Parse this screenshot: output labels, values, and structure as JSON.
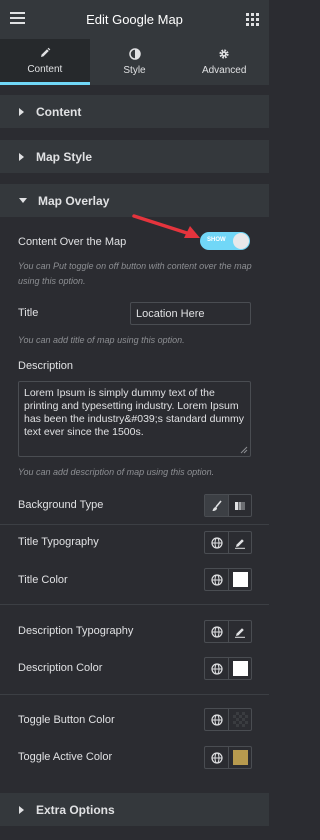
{
  "header": {
    "title": "Edit Google Map"
  },
  "tabs": [
    {
      "label": "Content",
      "active": true
    },
    {
      "label": "Style",
      "active": false
    },
    {
      "label": "Advanced",
      "active": false
    }
  ],
  "sections": {
    "content": "Content",
    "map_style": "Map Style",
    "map_overlay": "Map Overlay",
    "extra_options": "Extra Options"
  },
  "overlay": {
    "content_over_map": {
      "label": "Content Over the Map",
      "toggle_text": "SHOW",
      "enabled": true,
      "help": "You can Put toggle on off button with content over the map using this option."
    },
    "title": {
      "label": "Title",
      "value": "Location Here",
      "help": "You can add title of map using this option."
    },
    "description": {
      "label": "Description",
      "value": "Lorem Ipsum is simply dummy text of the printing and typesetting industry. Lorem Ipsum has been the industry&#039;s standard dummy text ever since the 1500s.",
      "help": "You can add description of map using this option."
    },
    "background_type": {
      "label": "Background Type"
    },
    "title_typography": {
      "label": "Title Typography"
    },
    "title_color": {
      "label": "Title Color",
      "color": "#ffffff"
    },
    "description_typography": {
      "label": "Description Typography"
    },
    "description_color": {
      "label": "Description Color",
      "color": "#ffffff"
    },
    "toggle_button_color": {
      "label": "Toggle Button Color",
      "color": "transparent"
    },
    "toggle_active_color": {
      "label": "Toggle Active Color",
      "color": "#b79a4e"
    }
  },
  "colors": {
    "accent": "#71d7f7",
    "panel": "#2b2c31",
    "header": "#34383c",
    "arrow": "#e5343d"
  }
}
